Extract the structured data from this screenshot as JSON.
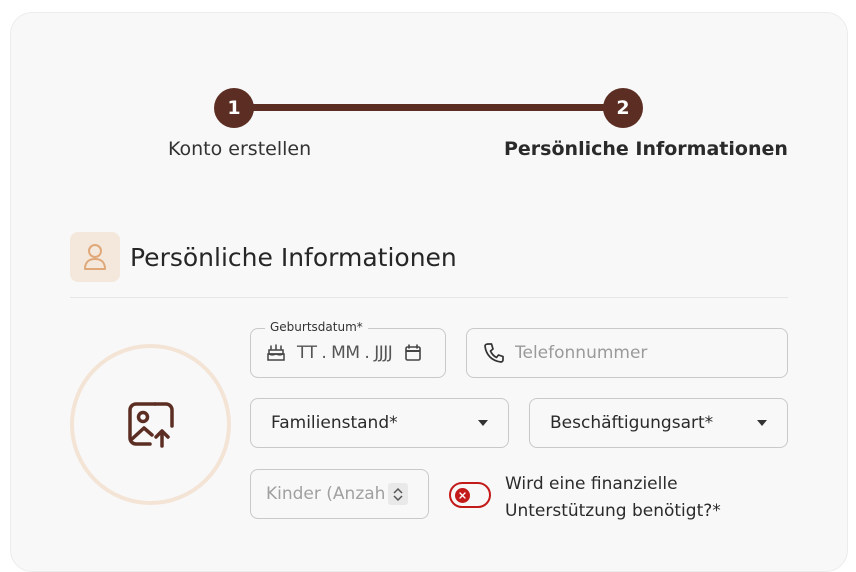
{
  "stepper": {
    "steps": [
      {
        "number": "1",
        "label": "Konto erstellen"
      },
      {
        "number": "2",
        "label": "Persönliche Informationen"
      }
    ]
  },
  "section": {
    "title": "Persönliche Informationen",
    "icon": "person-icon"
  },
  "avatar": {
    "icon": "image-upload-icon"
  },
  "form": {
    "birthdate": {
      "label": "Geburtsdatum*",
      "value": "TT . MM . JJJJ"
    },
    "phone": {
      "placeholder": "Telefonnummer"
    },
    "marital_status": {
      "label": "Familienstand*"
    },
    "employment_type": {
      "label": "Beschäftigungsart*"
    },
    "children": {
      "placeholder": "Kinder (Anzahl)*"
    },
    "financial_support": {
      "label": "Wird eine finanzielle Unterstützung benötigt?*",
      "checked": false
    }
  },
  "colors": {
    "primary": "#5c2e23",
    "accent_bg": "#f4e8dc",
    "toggle_off": "#c31a1a"
  }
}
